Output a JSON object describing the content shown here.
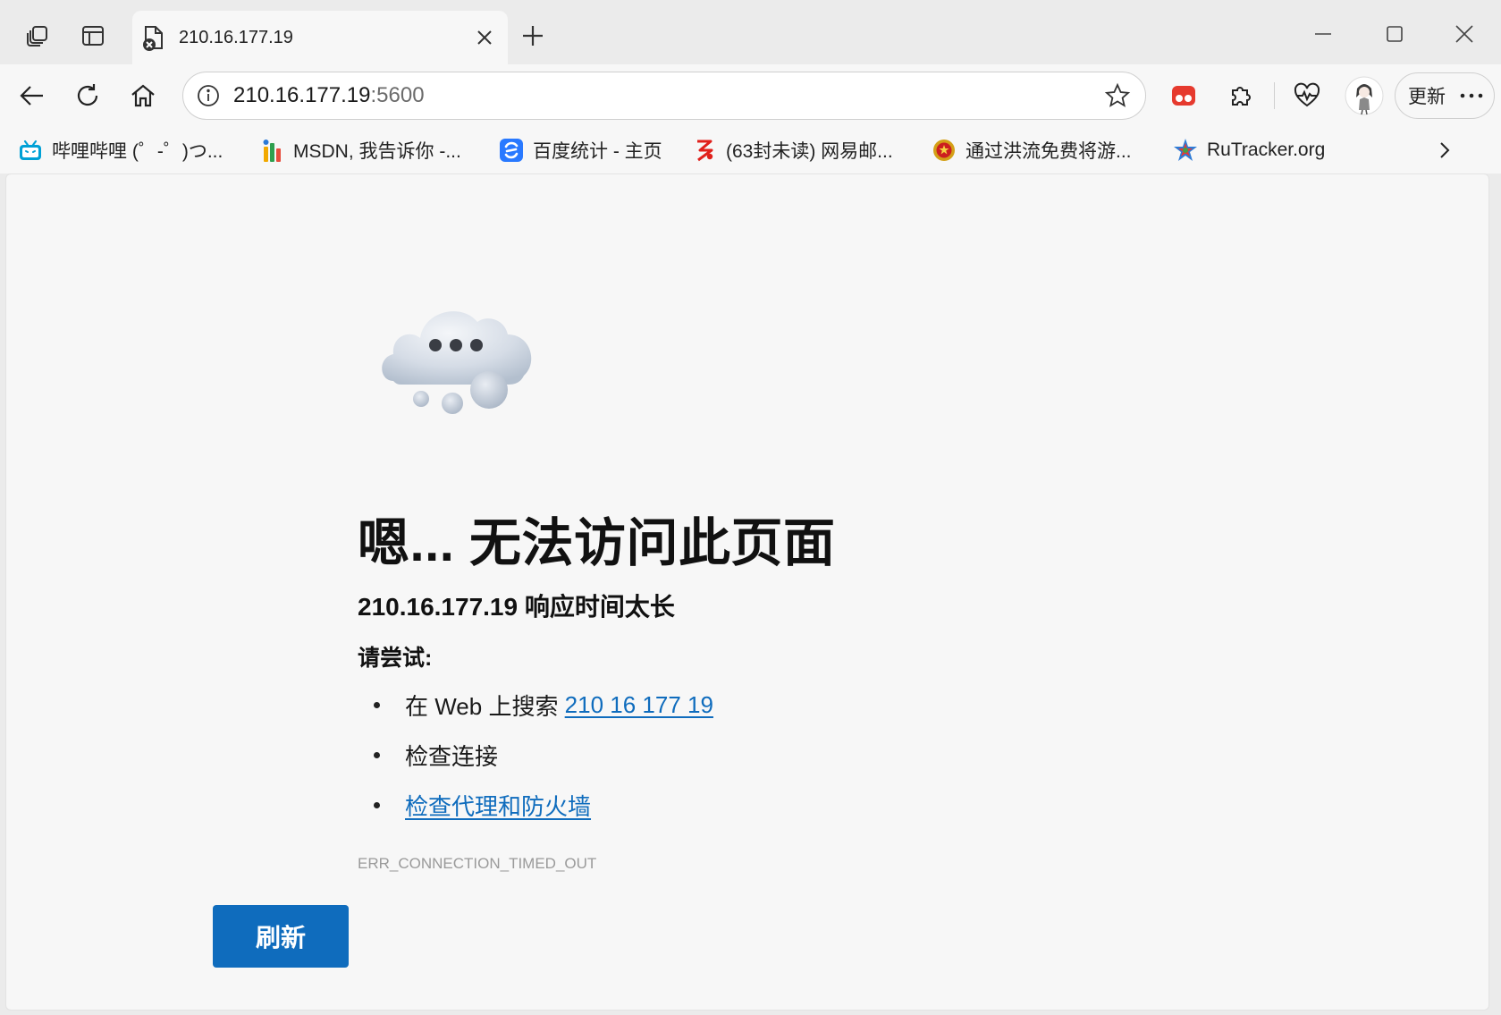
{
  "tab": {
    "title": "210.16.177.19"
  },
  "address_bar": {
    "host": "210.16.177.19",
    "port": ":5600"
  },
  "toolbar": {
    "update_label": "更新"
  },
  "bookmarks": [
    {
      "label": "哔哩哔哩 (゜-゜)つ...",
      "icon": "bilibili-icon"
    },
    {
      "label": "MSDN, 我告诉你 -...",
      "icon": "msdn-icon"
    },
    {
      "label": "百度统计 - 主页",
      "icon": "baidu-tongji-icon"
    },
    {
      "label": "(63封未读) 网易邮...",
      "icon": "netease-mail-icon"
    },
    {
      "label": "通过洪流免费将游...",
      "icon": "emblem-icon"
    },
    {
      "label": "RuTracker.org",
      "icon": "rutracker-icon"
    }
  ],
  "error_page": {
    "heading": "嗯... 无法访问此页面",
    "subheading": "210.16.177.19 响应时间太长",
    "try_label": "请尝试:",
    "suggestions": {
      "search_prefix": "在 Web 上搜索 ",
      "search_link": "210 16 177 19",
      "check_connection": "检查连接",
      "check_proxy_link": "检查代理和防火墙"
    },
    "error_code": "ERR_CONNECTION_TIMED_OUT",
    "refresh_button": "刷新"
  },
  "colors": {
    "accent": "#0f6cbd",
    "page_background": "#f7f7f7",
    "chrome_background": "#ebebeb"
  }
}
